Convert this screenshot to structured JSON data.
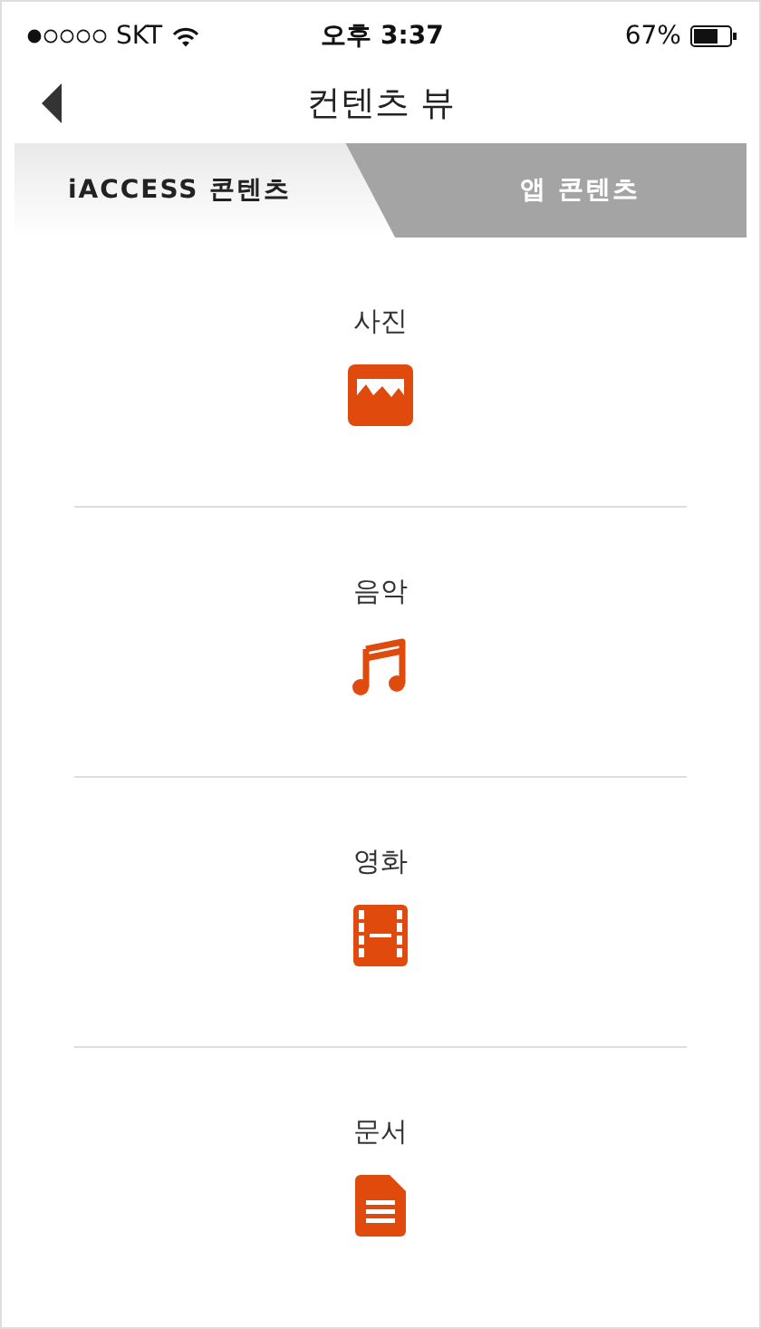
{
  "status_bar": {
    "carrier": "SKT",
    "time": "오후 3:37",
    "battery": "67%"
  },
  "nav": {
    "title": "컨텐츠 뷰"
  },
  "tabs": [
    {
      "label": "iACCESS 콘텐츠",
      "selected": true
    },
    {
      "label": "앱 콘텐츠",
      "selected": false
    }
  ],
  "items": [
    {
      "label": "사진",
      "kind": "photo"
    },
    {
      "label": "음악",
      "kind": "music"
    },
    {
      "label": "영화",
      "kind": "video"
    },
    {
      "label": "문서",
      "kind": "document"
    }
  ]
}
